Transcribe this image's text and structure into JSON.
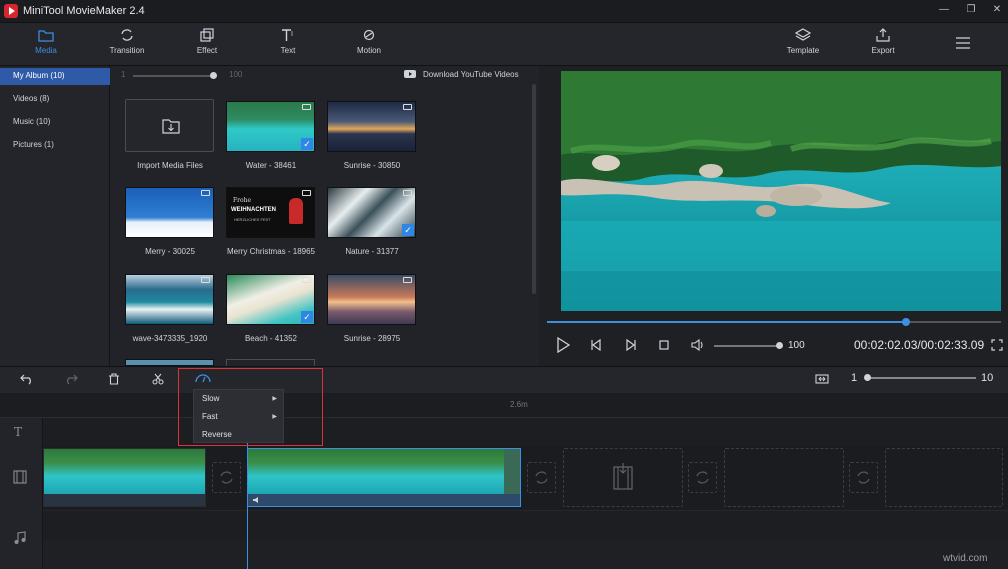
{
  "app": {
    "title": "MiniTool MovieMaker 2.4",
    "accent": "#3d8fe0",
    "logo_color": "#d8262f"
  },
  "window_controls": {
    "minimize": "minimize-icon",
    "maximize": "maximize-icon",
    "close": "close-icon"
  },
  "toolbar": {
    "tabs": [
      {
        "label": "Media",
        "icon": "folder-icon",
        "active": true
      },
      {
        "label": "Transition",
        "icon": "transition-icon",
        "active": false
      },
      {
        "label": "Effect",
        "icon": "effect-icon",
        "active": false
      },
      {
        "label": "Text",
        "icon": "text-icon",
        "active": false
      },
      {
        "label": "Motion",
        "icon": "motion-icon",
        "active": false
      }
    ],
    "right": [
      {
        "label": "Template",
        "icon": "layers-icon"
      },
      {
        "label": "Export",
        "icon": "export-icon"
      }
    ]
  },
  "sidebar": {
    "items": [
      {
        "label": "My Album",
        "count": "(10)",
        "active": true
      },
      {
        "label": "Videos",
        "count": "(8)",
        "active": false
      },
      {
        "label": "Music",
        "count": "(10)",
        "active": false
      },
      {
        "label": "Pictures",
        "count": "(1)",
        "active": false
      }
    ]
  },
  "media": {
    "zoom_min": "1",
    "zoom_max": "100",
    "download_link": "Download YouTube Videos",
    "import_label": "Import Media Files",
    "items": [
      {
        "name": "Water - 38461",
        "checked": true
      },
      {
        "name": "Sunrise - 30850",
        "checked": false
      },
      {
        "name": "Merry - 30025",
        "checked": false
      },
      {
        "name": "Merry Christmas - 18965",
        "checked": false
      },
      {
        "name": "Nature - 31377",
        "checked": true
      },
      {
        "name": "wave-3473335_1920",
        "checked": false
      },
      {
        "name": "Beach - 41352",
        "checked": true
      },
      {
        "name": "Sunrise - 28975",
        "checked": false
      }
    ],
    "xmas_text": {
      "line1": "Frohe",
      "line2": "WEIHNACHTEN",
      "line3": "HERZLICHES FEST"
    }
  },
  "player": {
    "progress": 0.79,
    "volume": "100",
    "timecode": "00:02:02.03/00:02:33.09"
  },
  "timeline": {
    "ruler_label": "2.6m",
    "zoom_min": "1",
    "zoom_max": "10",
    "speed_menu": {
      "items": [
        {
          "label": "Slow",
          "has_submenu": true
        },
        {
          "label": "Fast",
          "has_submenu": true
        },
        {
          "label": "Reverse",
          "has_submenu": false
        }
      ]
    }
  },
  "watermark": "wtvid.com"
}
